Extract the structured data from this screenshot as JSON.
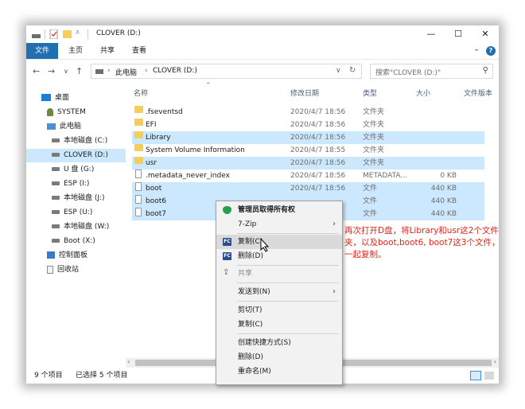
{
  "window": {
    "title": "CLOVER (D:)",
    "controls": {
      "minimize": "—",
      "maximize": "☐",
      "close": "✕"
    }
  },
  "ribbon": {
    "tabs": [
      "文件",
      "主页",
      "共享",
      "查看"
    ],
    "expand": "⌄",
    "help": "?"
  },
  "address": {
    "path": [
      "此电脑",
      "CLOVER (D:)"
    ],
    "search_placeholder": "搜索\"CLOVER (D:)\""
  },
  "nav_pane": {
    "items": [
      "桌面",
      "SYSTEM",
      "此电脑",
      "本地磁盘 (C:)",
      "CLOVER (D:)",
      "U 盘 (G:)",
      "ESP (I:)",
      "本地磁盘 (J:)",
      "ESP (U:)",
      "本地磁盘 (W:)",
      "Boot (X:)",
      "控制面板",
      "回收站"
    ]
  },
  "columns": {
    "name": "名称",
    "date": "修改日期",
    "type": "类型",
    "size": "大小",
    "version": "文件版本"
  },
  "files": [
    {
      "name": ".fseventsd",
      "date": "2020/4/7 18:56",
      "type": "文件夹",
      "size": "",
      "kind": "folder",
      "selected": false
    },
    {
      "name": "EFI",
      "date": "2020/4/7 18:56",
      "type": "文件夹",
      "size": "",
      "kind": "folder",
      "selected": false
    },
    {
      "name": "Library",
      "date": "2020/4/7 18:56",
      "type": "文件夹",
      "size": "",
      "kind": "folder",
      "selected": true
    },
    {
      "name": "System Volume Information",
      "date": "2020/4/7 18:55",
      "type": "文件夹",
      "size": "",
      "kind": "folder",
      "selected": false
    },
    {
      "name": "usr",
      "date": "2020/4/7 18:56",
      "type": "文件夹",
      "size": "",
      "kind": "folder",
      "selected": true
    },
    {
      "name": ".metadata_never_index",
      "date": "2020/4/7 18:56",
      "type": "METADATA...",
      "size": "0 KB",
      "kind": "file",
      "selected": false
    },
    {
      "name": "boot",
      "date": "2020/4/7 18:56",
      "type": "文件",
      "size": "440 KB",
      "kind": "file",
      "selected": true
    },
    {
      "name": "boot6",
      "date": "",
      "type": "文件",
      "size": "440 KB",
      "kind": "file",
      "selected": true
    },
    {
      "name": "boot7",
      "date": "",
      "type": "文件",
      "size": "440 KB",
      "kind": "file",
      "selected": true
    }
  ],
  "status": {
    "count": "9 个项目",
    "selected": "已选择 5 个项目"
  },
  "context_menu": {
    "admin": "管理员取得所有权",
    "zip": "7-Zip",
    "copy_fc": "复制(C)",
    "delete_fc": "删除(D)",
    "share": "共享",
    "send_to": "发送到(N)",
    "cut": "剪切(T)",
    "copy": "复制(C)",
    "create_shortcut": "创建快捷方式(S)",
    "delete": "删除(D)",
    "rename": "重命名(M)",
    "fc_icon": "FC"
  },
  "annotation": "再次打开D盘，将Library和usr这2个文件夹，以及boot,boot6, boot7这3个文件，一起复制。",
  "colors": {
    "accent": "#1f6fb2",
    "selection": "#cce8ff",
    "annotation": "#e0241b"
  }
}
